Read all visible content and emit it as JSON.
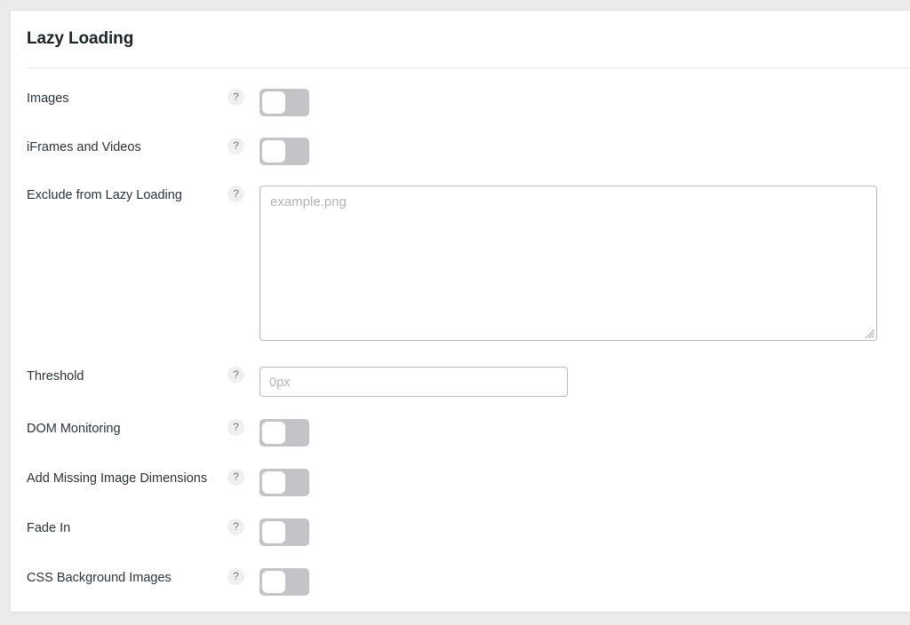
{
  "page": {
    "background_color": "#ebebeb",
    "card_background": "#ffffff"
  },
  "panel": {
    "title": "Lazy Loading"
  },
  "colors": {
    "toggle_track_off": "#c3c4c7",
    "toggle_knob": "#ffffff",
    "label_text": "#2c3338",
    "title_text": "#1d2327",
    "placeholder_text": "#b5b5b5",
    "help_icon_bg": "#f0f0f1",
    "border": "#b9b9b9"
  },
  "help_icon_glyph": "?",
  "rows": {
    "images": {
      "label": "Images",
      "help": "?",
      "control": "toggle",
      "state": "off"
    },
    "iframes": {
      "label": "iFrames and Videos",
      "help": "?",
      "control": "toggle",
      "state": "off"
    },
    "exclude": {
      "label": "Exclude from Lazy Loading",
      "help": "?",
      "control": "textarea",
      "placeholder": "example.png",
      "value": ""
    },
    "threshold": {
      "label": "Threshold",
      "help": "?",
      "control": "text",
      "placeholder": "0px",
      "value": ""
    },
    "dom_monitoring": {
      "label": "DOM Monitoring",
      "help": "?",
      "control": "toggle",
      "state": "off"
    },
    "image_dimensions": {
      "label": "Add Missing Image Dimensions",
      "help": "?",
      "control": "toggle",
      "state": "off"
    },
    "fade_in": {
      "label": "Fade In",
      "help": "?",
      "control": "toggle",
      "state": "off"
    },
    "css_background": {
      "label": "CSS Background Images",
      "help": "?",
      "control": "toggle",
      "state": "off"
    }
  }
}
